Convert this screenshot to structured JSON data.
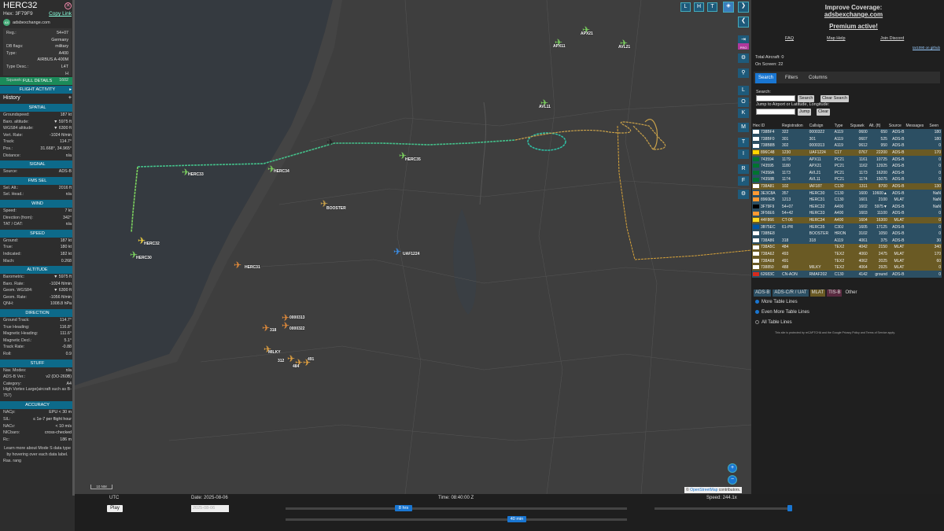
{
  "selected": {
    "callsign": "HERC32",
    "hex_label": "Hex:",
    "hex": "3F79F9",
    "copy_link": "Copy Link",
    "source_site": "adsbexchange.com",
    "fields": [
      [
        "Reg.:",
        "54+07"
      ],
      [
        "",
        "Germany"
      ],
      [
        "DB flags:",
        "military"
      ],
      [
        "Type:",
        "A400"
      ],
      [
        "",
        "AIRBUS A-400M"
      ],
      [
        "Type Desc.:",
        "L4T"
      ],
      [
        "",
        "H"
      ],
      [
        "Squawk:",
        "1602"
      ]
    ],
    "full_details": "FULL DETAILS",
    "flight_activity": "FLIGHT ACTIVITY",
    "history": "History",
    "sections": [
      {
        "title": "SPATIAL",
        "rows": [
          [
            "Groundspeed:",
            "187 kt"
          ],
          [
            "Baro. altitude:",
            "▼ 5975 ft"
          ],
          [
            "WGS84 altitude:",
            "▼ 6300 ft"
          ],
          [
            "Vert. Rate:",
            "-1024 ft/min"
          ],
          [
            "Track:",
            "114.7°"
          ],
          [
            "Pos.:",
            "31.668°, 34.965°"
          ],
          [
            "Distance:",
            "n/a"
          ]
        ]
      },
      {
        "title": "SIGNAL",
        "rows": [
          [
            "Source:",
            "ADS-B"
          ]
        ]
      },
      {
        "title": "FMS SEL",
        "rows": [
          [
            "Sel. Alt.:",
            "2016 ft"
          ],
          [
            "Sel. Head.:",
            "n/a"
          ]
        ]
      },
      {
        "title": "WIND",
        "rows": [
          [
            "Speed:",
            "7 kt"
          ],
          [
            "Direction (from):",
            "342°"
          ],
          [
            "TAT / OAT:",
            "n/a"
          ]
        ]
      },
      {
        "title": "SPEED",
        "rows": [
          [
            "Ground:",
            "187 kt"
          ],
          [
            "True:",
            "180 kt"
          ],
          [
            "Indicated:",
            "182 kt"
          ],
          [
            "Mach:",
            "0.268"
          ]
        ]
      },
      {
        "title": "ALTITUDE",
        "rows": [
          [
            "Barometric:",
            "▼ 5975 ft"
          ],
          [
            "Baro. Rate:",
            "-1024 ft/min"
          ],
          [
            "Geom. WGS84:",
            "▼ 6300 ft"
          ],
          [
            "Geom. Rate:",
            "-1056 ft/min"
          ],
          [
            "QNH:",
            "1008.8 hPa"
          ]
        ]
      },
      {
        "title": "DIRECTION",
        "rows": [
          [
            "Ground Track:",
            "114.7°"
          ],
          [
            "True Heading:",
            "116.8°"
          ],
          [
            "Magnetic Heading:",
            "111.6°"
          ],
          [
            "Magnetic Decl.:",
            "5.1°"
          ],
          [
            "Track Rate:",
            "-0.88"
          ],
          [
            "Roll:",
            "0.9"
          ]
        ]
      },
      {
        "title": "STUFF",
        "rows": [
          [
            "Nav. Modes:",
            "n/a"
          ],
          [
            "ADS-B Ver.:",
            "v2 (DO-260B)"
          ],
          [
            "Category:",
            "A4"
          ],
          [
            "High Vortex Large(aircraft such as B-757)",
            ""
          ]
        ]
      },
      {
        "title": "ACCURACY",
        "rows": [
          [
            "NACp:",
            "EPU < 30 m"
          ],
          [
            "SIL:",
            "≤ 1e-7 per flight hour"
          ],
          [
            "NACv:",
            "< 10 m/s"
          ],
          [
            "NICbaro:",
            "cross-checked"
          ],
          [
            "Rc:",
            "186 m"
          ]
        ]
      }
    ],
    "learn_more": "Learn more about Mode S data type by hovering over each data label.",
    "partial": "Ras. rang"
  },
  "map": {
    "attribution_prefix": "© ",
    "attribution_link": "OpenStreetMap",
    "attribution_suffix": " contributors.",
    "scale_label": "10 NM",
    "top_buttons": [
      "L",
      "H",
      "T"
    ],
    "side_buttons": [
      "L",
      "O",
      "K",
      "M",
      "T",
      "I",
      "R",
      "F"
    ],
    "zoom_in": "+",
    "zoom_out": "−",
    "aircraft_labels": [
      "APX21",
      "APX11",
      "AVL21",
      "AVL11",
      "HERC35",
      "HERC33",
      "HERC34",
      "BOOSTER",
      "HERC32",
      "HERC30",
      "UAF1224",
      "HERC31",
      "318",
      "0000313",
      "0000322",
      "MILKY",
      "312",
      "484",
      "491"
    ]
  },
  "bottom": {
    "utc": "UTC",
    "play": "Play",
    "date": "Date: 2025-08-06",
    "date_input": "2025-08-06",
    "time": "Time: 08:40:00 Z",
    "speed": "Speed: 244.1x",
    "duration_handle": "8 hrs",
    "window_handle": "40 min"
  },
  "right": {
    "improve_title": "Improve Coverage:",
    "improve_link": "adsbexchange.com",
    "premium": "Premium active!",
    "links": [
      "FAQ",
      "Map Help",
      "Join Discord"
    ],
    "version": "tar1090 on github",
    "total_aircraft": "Total Aircraft: 0",
    "on_screen": "On Screen: 22",
    "tabs": [
      "Search",
      "Filters",
      "Columns"
    ],
    "search_label": "Search:",
    "search_btn": "Search",
    "clear_search_btn": "Clear Search",
    "jump_label": "Jump to Airport or Latitude, Longitude:",
    "jump_btn": "Jump",
    "clear_btn": "Clear",
    "columns": [
      "Hex ID",
      "Registration",
      "Callsign",
      "Type",
      "Squawk",
      "Alt. (ft)",
      "Source",
      "Messages",
      "Seen"
    ],
    "rows": [
      {
        "flag": "il",
        "cells": [
          "738BF4",
          "322",
          "0000322",
          "A119",
          "0600",
          "650",
          "ADS-B",
          "",
          "180"
        ],
        "tone": "blue"
      },
      {
        "flag": "il",
        "cells": [
          "738BF0",
          "301",
          "301",
          "A119",
          "0607",
          "525",
          "ADS-B",
          "",
          "180"
        ],
        "tone": "blue"
      },
      {
        "flag": "il",
        "cells": [
          "738B8B",
          "302",
          "0000313",
          "A119",
          "0612",
          "950",
          "ADS-B",
          "",
          "0"
        ],
        "tone": "blue"
      },
      {
        "flag": "ua",
        "cells": [
          "896C48",
          "1230",
          "UAF1224",
          "C17",
          "0767",
          "22200",
          "ADS-B",
          "",
          "170"
        ],
        "tone": "gold"
      },
      {
        "flag": "ae",
        "cells": [
          "743594",
          "1179",
          "APX11",
          "PC21",
          "1161",
          "10725",
          "ADS-B",
          "",
          "0"
        ],
        "tone": "blue"
      },
      {
        "flag": "ae",
        "cells": [
          "743595",
          "1180",
          "APX21",
          "PC21",
          "1162",
          "12925",
          "ADS-B",
          "",
          "0"
        ],
        "tone": "blue"
      },
      {
        "flag": "ae",
        "cells": [
          "74358A",
          "1173",
          "AVL21",
          "PC21",
          "1173",
          "16200",
          "ADS-B",
          "",
          "0"
        ],
        "tone": "blue"
      },
      {
        "flag": "ae",
        "cells": [
          "74358B",
          "1174",
          "AVL11",
          "PC21",
          "1174",
          "15075",
          "ADS-B",
          "",
          "0"
        ],
        "tone": "blue"
      },
      {
        "flag": "il",
        "cells": [
          "738A81",
          "102",
          "IAF187",
          "C130",
          "1311",
          "8700",
          "ADS-B",
          "",
          "130"
        ],
        "tone": "gold"
      },
      {
        "flag": "in",
        "cells": [
          "3E3C8A",
          "357",
          "HERC30",
          "C130",
          "1600",
          "10600▲",
          "ADS-B",
          "",
          "NaN"
        ],
        "tone": "blue"
      },
      {
        "flag": "in",
        "cells": [
          "8960EB",
          "1213",
          "HERC31",
          "C130",
          "1601",
          "2100",
          "MLAT",
          "",
          "NaN"
        ],
        "tone": "blue"
      },
      {
        "flag": "de",
        "cells": [
          "3F79F9",
          "54+07",
          "HERC32",
          "A400",
          "1602",
          "5975▼",
          "ADS-B",
          "",
          "NaN"
        ],
        "tone": "blue"
      },
      {
        "flag": "in",
        "cells": [
          "3F56E6",
          "54+42",
          "HERC33",
          "A400",
          "1603",
          "11100",
          "ADS-B",
          "",
          "0"
        ],
        "tone": "blue"
      },
      {
        "flag": "be",
        "cells": [
          "44F866",
          "CT-06",
          "HERC34",
          "A400",
          "1604",
          "16300",
          "MLAT",
          "",
          "0"
        ],
        "tone": "gold"
      },
      {
        "flag": "fr",
        "cells": [
          "3B75EC",
          "61-PR",
          "HERC35",
          "C30J",
          "1605",
          "17125",
          "ADS-B",
          "",
          "0"
        ],
        "tone": "blue"
      },
      {
        "flag": "il",
        "cells": [
          "738BE8",
          "",
          "BOOSTER",
          "HRON",
          "3102",
          "1050",
          "ADS-B",
          "",
          "0"
        ],
        "tone": "blue"
      },
      {
        "flag": "il",
        "cells": [
          "738A86",
          "318",
          "318",
          "A119",
          "4061",
          "375",
          "ADS-B",
          "",
          "30"
        ],
        "tone": "blue"
      },
      {
        "flag": "il",
        "cells": [
          "738A5C",
          "484",
          "",
          "TEX2",
          "4042",
          "2150",
          "MLAT",
          "",
          "340"
        ],
        "tone": "gold"
      },
      {
        "flag": "il",
        "cells": [
          "738A62",
          "493",
          "",
          "TEX2",
          "4060",
          "2475",
          "MLAT",
          "",
          "170"
        ],
        "tone": "gold"
      },
      {
        "flag": "il",
        "cells": [
          "738A68",
          "491",
          "",
          "TEX2",
          "4062",
          "2025",
          "MLAT",
          "",
          "60"
        ],
        "tone": "gold"
      },
      {
        "flag": "il",
        "cells": [
          "738850",
          "488",
          "MILKY",
          "TEX2",
          "4064",
          "2925",
          "MLAT",
          "",
          "0"
        ],
        "tone": "gold"
      },
      {
        "flag": "ca",
        "cells": [
          "62683C",
          "CN-AON",
          "RMAF202",
          "C130",
          "4142",
          "ground",
          "ADS-B",
          "",
          "0"
        ],
        "tone": "blue"
      }
    ],
    "legend": [
      "ADS-B",
      "ADS-C/R / UAT",
      "MLAT",
      "TIS-B",
      "Other"
    ],
    "more_lines": "More Table Lines",
    "even_more_lines": "Even More Table Lines",
    "all_lines": "All Table Lines",
    "recaptcha": "This site is protected by reCAPTCHA and the Google Privacy Policy and Terms of Service apply."
  },
  "colors": {
    "panel_header": "#0d6a8a",
    "row_blue": "#2c4f63",
    "row_gold": "#6a5a24",
    "accent": "#1976d2"
  }
}
